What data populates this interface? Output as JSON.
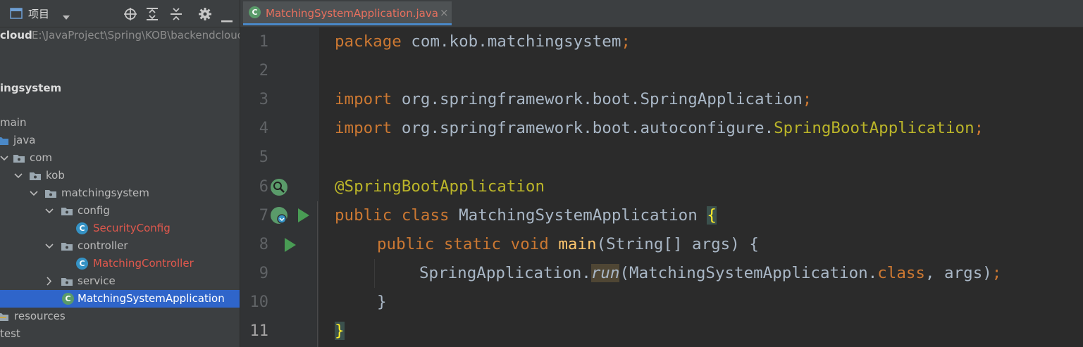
{
  "project_toolbar": {
    "view_label": "项目",
    "icons": [
      "window-icon",
      "dropdown-icon",
      "locate-icon",
      "expand-all-icon",
      "collapse-all-icon",
      "settings-icon",
      "minimize-icon"
    ]
  },
  "tree": {
    "root": {
      "name": "cloud",
      "path": "E:\\JavaProject\\Spring\\KOB\\backendcloud"
    },
    "rows": [
      {
        "label": "ingsystem"
      },
      {
        "label": "main"
      },
      {
        "label": "java"
      },
      {
        "label": "com"
      },
      {
        "label": "kob"
      },
      {
        "label": "matchingsystem"
      },
      {
        "label": "config"
      },
      {
        "label": "SecurityConfig"
      },
      {
        "label": "controller"
      },
      {
        "label": "MatchingController"
      },
      {
        "label": "service"
      },
      {
        "label": "MatchingSystemApplication"
      },
      {
        "label": "resources"
      },
      {
        "label": "test"
      }
    ]
  },
  "tab": {
    "title": "MatchingSystemApplication.java",
    "close": "×"
  },
  "gutter": {
    "line_numbers": [
      "1",
      "2",
      "3",
      "4",
      "5",
      "6",
      "7",
      "8",
      "9",
      "10",
      "11"
    ]
  },
  "code": {
    "l1": [
      "package",
      " com.kob.matchingsystem",
      ";"
    ],
    "l3": [
      "import",
      " org.springframework.boot.SpringApplication",
      ";"
    ],
    "l4": [
      "import",
      " org.springframework.boot.autoconfigure.",
      "SpringBootApplication",
      ";"
    ],
    "l6": [
      "@SpringBootApplication"
    ],
    "l7": [
      "public class",
      " MatchingSystemApplication ",
      "{"
    ],
    "l8": [
      "public static void",
      " ",
      "main",
      "(String[] args) {"
    ],
    "l9": [
      "SpringApplication.",
      "run",
      "(MatchingSystemApplication.",
      "class",
      ", args)",
      ";"
    ],
    "l10": [
      "}"
    ],
    "l11": [
      "}"
    ]
  },
  "colors": {
    "keyword": "#cc7832",
    "annotation": "#bbb529",
    "method": "#ffc66d",
    "text": "#a9b7c6",
    "selection": "#2f65ca",
    "run": "#499c54"
  }
}
